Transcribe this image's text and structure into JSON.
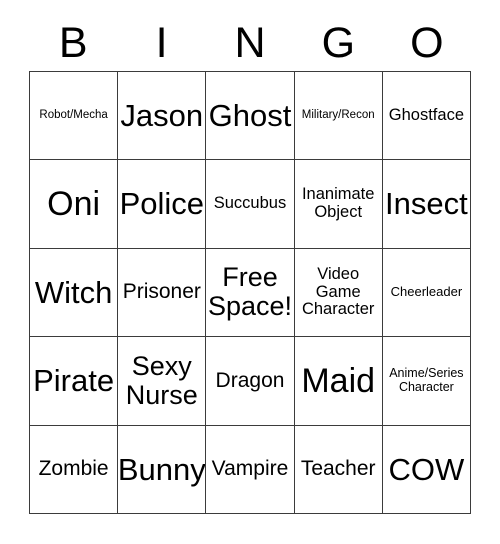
{
  "card": {
    "type": "bingo-card",
    "header": {
      "letters": [
        "B",
        "I",
        "N",
        "G",
        "O"
      ]
    },
    "grid": {
      "columns": 5,
      "rows": 5,
      "free_space_index": 12,
      "cells": [
        {
          "text": "Robot/Mecha",
          "size": "xs"
        },
        {
          "text": "Jason",
          "size": "xxl"
        },
        {
          "text": "Ghost",
          "size": "xxl"
        },
        {
          "text": "Military/Recon",
          "size": "xs"
        },
        {
          "text": "Ghostface",
          "size": "md"
        },
        {
          "text": "Oni",
          "size": "huge"
        },
        {
          "text": "Police",
          "size": "xxl"
        },
        {
          "text": "Succubus",
          "size": "md"
        },
        {
          "text": "Inanimate\nObject",
          "size": "md"
        },
        {
          "text": "Insect",
          "size": "xxl"
        },
        {
          "text": "Witch",
          "size": "xxl"
        },
        {
          "text": "Prisoner",
          "size": "lg"
        },
        {
          "text": "Free\nSpace!",
          "size": "xl"
        },
        {
          "text": "Video\nGame\nCharacter",
          "size": "md"
        },
        {
          "text": "Cheerleader",
          "size": "sm"
        },
        {
          "text": "Pirate",
          "size": "xxl"
        },
        {
          "text": "Sexy\nNurse",
          "size": "xl"
        },
        {
          "text": "Dragon",
          "size": "lg"
        },
        {
          "text": "Maid",
          "size": "huge"
        },
        {
          "text": "Anime/Series\nCharacter",
          "size": "smm"
        },
        {
          "text": "Zombie",
          "size": "lg"
        },
        {
          "text": "Bunny",
          "size": "xxl"
        },
        {
          "text": "Vampire",
          "size": "lg"
        },
        {
          "text": "Teacher",
          "size": "lg"
        },
        {
          "text": "COW",
          "size": "xxl"
        }
      ]
    },
    "colors": {
      "background": "#ffffff",
      "text": "#000000",
      "grid_line": "#3b3b3b"
    }
  }
}
